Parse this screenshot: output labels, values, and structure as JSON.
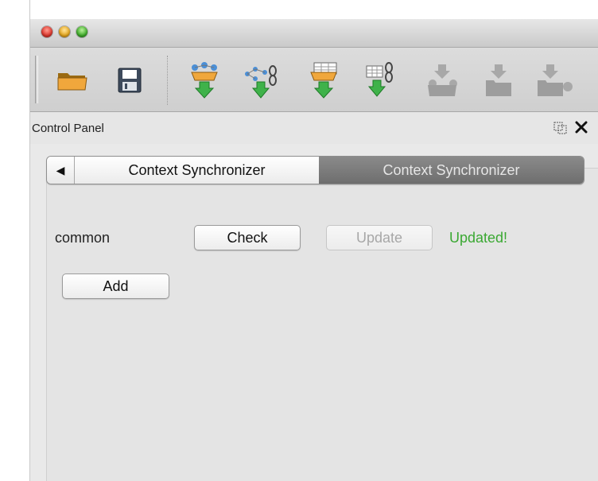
{
  "toolbar": {
    "buttons": [
      {
        "icon": "open-folder-icon",
        "enabled": true
      },
      {
        "icon": "save-disk-icon",
        "enabled": true
      },
      {
        "icon": "import-network-icon",
        "enabled": true
      },
      {
        "icon": "import-network-chain-icon",
        "enabled": true
      },
      {
        "icon": "import-table-icon",
        "enabled": true
      },
      {
        "icon": "import-table-chain-icon",
        "enabled": true
      },
      {
        "icon": "import-network-disabled-icon",
        "enabled": false
      },
      {
        "icon": "import-folder-disabled-icon",
        "enabled": false
      },
      {
        "icon": "import-folder-network-disabled-icon",
        "enabled": false
      }
    ]
  },
  "panel": {
    "title": "Control Panel",
    "float_icon": "float-panel-icon",
    "close_icon": "close-icon"
  },
  "tabs": {
    "arrow": "◀",
    "items": [
      {
        "label": "Context Synchronizer",
        "selected": false
      },
      {
        "label": "Context Synchronizer",
        "selected": true
      }
    ]
  },
  "content": {
    "row_label": "common",
    "check_label": "Check",
    "update_label": "Update",
    "status_text": "Updated!",
    "add_label": "Add"
  },
  "colors": {
    "status_green": "#3aa832",
    "selected_tab": "#7c7c7c"
  }
}
